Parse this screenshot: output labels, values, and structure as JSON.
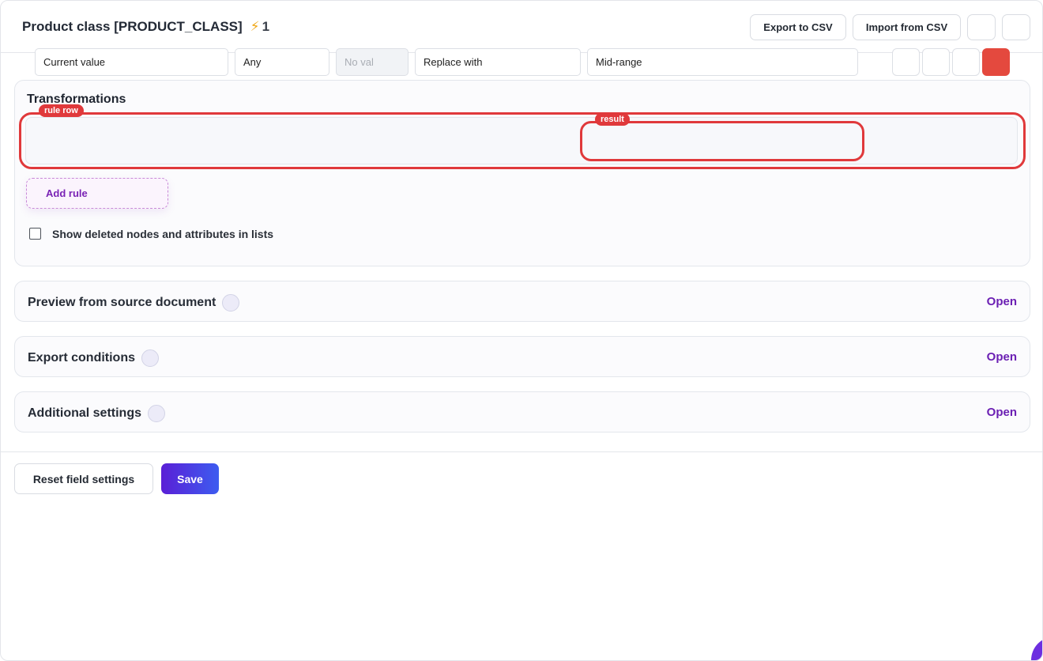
{
  "header": {
    "title": "Product class [PRODUCT_CLASS]",
    "bolt_icon": "⚡",
    "count": "1",
    "export_label": "Export to CSV",
    "import_label": "Import from CSV"
  },
  "transformations": {
    "title": "Transformations",
    "rule_row_tag": "rule row",
    "result_tag": "result",
    "rule": {
      "source": "Current value",
      "condition": "Any",
      "condition_value_placeholder": "No val",
      "action": "Replace with",
      "result": "Mid-range"
    },
    "add_rule_label": "Add rule",
    "show_deleted_label": "Show deleted nodes and attributes in lists",
    "show_deleted_checked": false
  },
  "sections": [
    {
      "title": "Preview from source document",
      "action": "Open"
    },
    {
      "title": "Export conditions",
      "action": "Open"
    },
    {
      "title": "Additional settings",
      "action": "Open"
    }
  ],
  "footer": {
    "reset_label": "Reset field settings",
    "save_label": "Save"
  },
  "colors": {
    "accent_purple": "#6b1fb3",
    "highlight_red": "#e0393b",
    "delete_red": "#e4493e",
    "save_gradient_start": "#5a1fd6",
    "save_gradient_end": "#3d5cf0"
  }
}
